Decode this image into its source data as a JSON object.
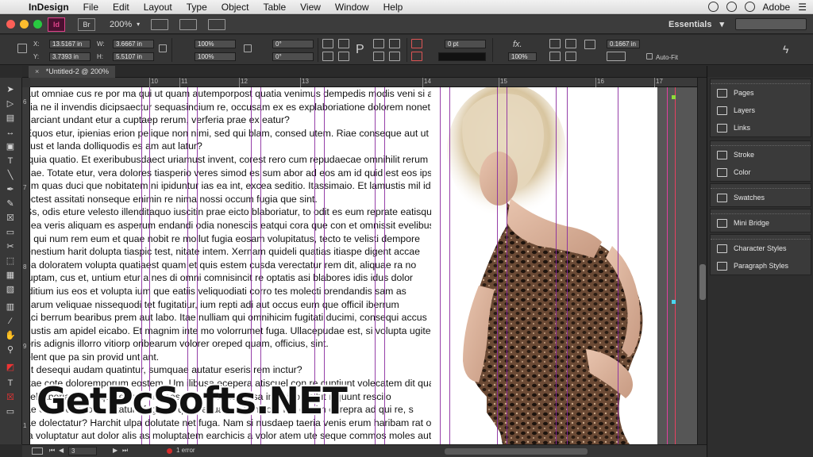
{
  "menubar": {
    "apple_icon": "apple-icon",
    "app_name": "InDesign",
    "items": [
      "File",
      "Edit",
      "Layout",
      "Type",
      "Object",
      "Table",
      "View",
      "Window",
      "Help"
    ],
    "right_text": "Adobe"
  },
  "appbar": {
    "logo": "Id",
    "bridge": "Br",
    "zoom": "200%",
    "workspace": "Essentials",
    "workspace_arrow": "▾"
  },
  "control": {
    "x_label": "X:",
    "y_label": "Y:",
    "w_label": "W:",
    "h_label": "H:",
    "x_value": "13.5167 in",
    "y_value": "3.7393 in",
    "w_value": "3.6667 in",
    "h_value": "5.5107 in",
    "scale_x": "100%",
    "scale_y": "100%",
    "rotate": "0°",
    "shear": "0°",
    "stroke_weight": "0 pt",
    "opacity": "100%",
    "gutter": "0.1667 in",
    "autofit": "Auto-Fit"
  },
  "document": {
    "tab_title": "*Untitled-2 @ 200%",
    "close": "×",
    "ruler_numbers": [
      "10",
      "11",
      "12",
      "13",
      "14",
      "15",
      "16",
      "17"
    ],
    "vruler_numbers": [
      "6",
      "7",
      "8",
      "9",
      "1"
    ],
    "text_lines": [
      "aut omniae cus re por ma qui ut quam autemporpost quatia venimus dempedis modis veni si as aut volor eos del eaquasp",
      "itia ne il invendis dicipsaectur sequasincium re, occusam ex es explaboriatione dolorem nonet ell ererrumquo mincit",
      "harciant undant etur a cuptaep rerum, verferia prae ex eatur?",
      "Equos etur, ipienias erion pelique non nimi, sed qui blam, consed utem. Riae conseque aut ut quis Soloruptias",
      "cust et landa dolliquodis es am aut latur?",
      "Iquia quatio. Et exeribubusdaect uriamust invent, corest rero cum repudaecae omnihilit rerum ad dolt conse",
      "nae. Totate etur, vera dolores tiasperio veres simod es sum abor ad eos am id quid est eos ipsam mossus",
      "um quas duci que nobitatem ni ipiduntur ias ea int, excea seditio. Itassimaio. Et lamustis mil idipid ditio",
      "octest assitati nonseque enimin re nima nossi occum fugia que sint.",
      "Ss, odis eture velesto illenditaquo iuscitin prae eicto blaboriatur, to odit es eum reprate eatisqui om",
      "nea veris aliquam es asperum endandi odia nonesciis eatqui cora que con et omnissit evelibus du",
      "n qui num rem eum et quae nobit re mollut fugia eosam volupitatus, tecto te velisti dempore",
      "enestium harit dolupta tiaspic test, nitate intem. Xernam quideli quatias itiaspe digent accae",
      "ea doloratem volupta quatiaest quam et quis estem cusda verectatur rem dit, aliquae ra no",
      "luptam, cus et, untium etur a nes di omni comnisincit re optatis asi blabores idis idus dolor",
      "iditium ius eos et volupta ium que eatiis veliquodiati corro tes molecti orendandis sam as",
      "harum veliquae nissequodi tet fugitatiur, ium repti adi aut occus eum que officil iberrum",
      "aci berrum bearibus prem aut labo. Itae nulliam qui omnihicim fugitati ducimi, consequi accus",
      "nustis am apidel eicabo. Et magnim inte mo volorrumet fuga. Ullacepudae est, si volupta ugite dion",
      "oris adignis illorro vitiorp oribearum volorer oreped quam, officius, sint.",
      "elent que pa sin provid unt ant.",
      "ut desequi audam quatintur, sumquae autatur eseris rem inctur?",
      "Itae cote doloremporum eostem. Um ilibusa ecepera atiscuel con re cuptiunt volecatem dit quas",
      "vell aboria quam que eaque natiaesse quas inciatinusa inverit omnihit isquunt rescilo",
      "ae esto dolorpores sitatum fugiam, que sequamend molore mo denim et repra ad qui re, s",
      "ae dolectatur? Harchit ulpa dolutate net fuga. Nam si nusdaep taeria venis erum haribam rat officati",
      "ia voluptatur aut dolor alis as moluptatem earchicis a volor atem ute seque commos moles aut quat"
    ]
  },
  "panels": {
    "items": [
      {
        "label": "Pages",
        "icon": "pages-icon"
      },
      {
        "label": "Layers",
        "icon": "layers-icon"
      },
      {
        "label": "Links",
        "icon": "links-icon"
      },
      {
        "label": "Stroke",
        "icon": "stroke-icon"
      },
      {
        "label": "Color",
        "icon": "color-icon"
      },
      {
        "label": "Swatches",
        "icon": "swatches-icon"
      },
      {
        "label": "Mini Bridge",
        "icon": "mini-bridge-icon"
      },
      {
        "label": "Character Styles",
        "icon": "character-styles-icon"
      },
      {
        "label": "Paragraph Styles",
        "icon": "paragraph-styles-icon"
      }
    ]
  },
  "status": {
    "page": "3",
    "errors": "1 error"
  },
  "watermark": "GetPcSofts.NET",
  "colors": {
    "accent_pink": "#e0448a",
    "guide_purple": "#8a2a9e",
    "error_red": "#d52b2b"
  }
}
